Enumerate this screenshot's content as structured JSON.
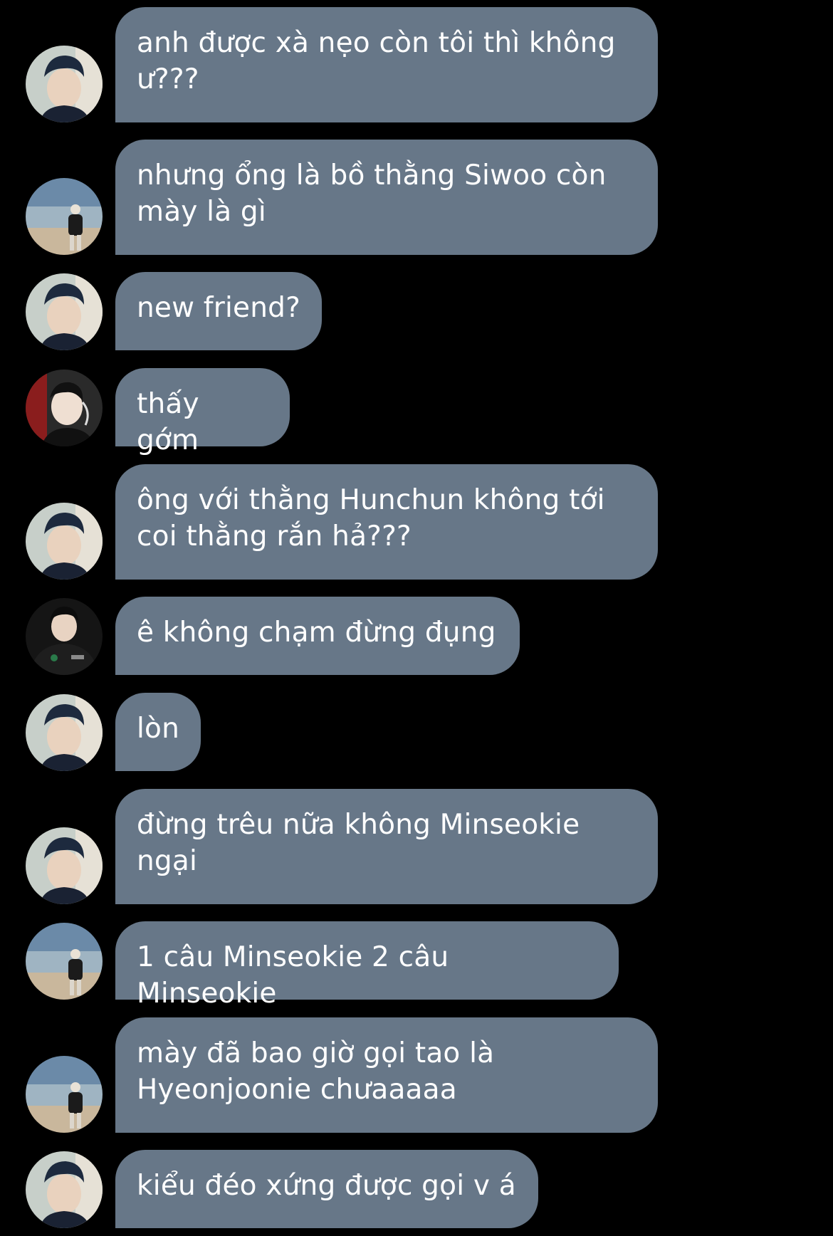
{
  "theme": {
    "background": "#000000",
    "bubble_color": "#677788",
    "text_color": "#ffffff"
  },
  "avatars": {
    "a": {
      "icon": "person-dark-blue-hair-avatar",
      "colors": [
        "#1d2a3e",
        "#e9d2be",
        "#c7cfc9"
      ]
    },
    "b": {
      "icon": "person-on-beach-avatar",
      "colors": [
        "#6b8aa8",
        "#c9b79c",
        "#1b1b1b"
      ]
    },
    "c": {
      "icon": "person-headset-avatar",
      "colors": [
        "#2a2a2a",
        "#efdfd2",
        "#8a1d1d"
      ]
    },
    "d": {
      "icon": "person-black-jersey-avatar",
      "colors": [
        "#151515",
        "#e8d3c2",
        "#2a7a4a"
      ]
    }
  },
  "messages": [
    {
      "avatar": "a",
      "text": "anh được xà nẹo còn tôi thì không ư???"
    },
    {
      "avatar": "b",
      "text": "nhưng ổng là bồ thằng Siwoo còn mày là gì"
    },
    {
      "avatar": "a",
      "text": "new friend?"
    },
    {
      "avatar": "c",
      "text": "thấy gớm"
    },
    {
      "avatar": "a",
      "text": "ông với thằng Hunchun không tới coi thằng rắn hả???"
    },
    {
      "avatar": "d",
      "text": "ê không chạm đừng đụng"
    },
    {
      "avatar": "a",
      "text": "lòn"
    },
    {
      "avatar": "a",
      "text": "đừng trêu nữa không Minseokie ngại"
    },
    {
      "avatar": "b",
      "text": "1 câu Minseokie 2 câu Minseokie"
    },
    {
      "avatar": "b",
      "text": "mày đã bao giờ gọi tao là Hyeonjoonie chưaaaaa"
    },
    {
      "avatar": "a",
      "text": "kiểu đéo xứng được gọi v á"
    }
  ]
}
